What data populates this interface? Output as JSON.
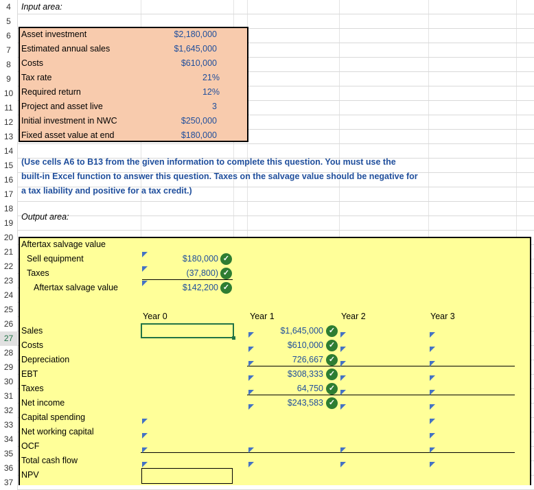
{
  "row_numbers": [
    "4",
    "5",
    "6",
    "7",
    "8",
    "9",
    "10",
    "11",
    "12",
    "13",
    "14",
    "15",
    "16",
    "17",
    "18",
    "19",
    "20",
    "21",
    "22",
    "23",
    "24",
    "25",
    "26",
    "27",
    "28",
    "29",
    "30",
    "31",
    "32",
    "33",
    "34",
    "35",
    "36",
    "37"
  ],
  "input": {
    "header": "Input area:",
    "labels": [
      "Asset investment",
      "Estimated annual sales",
      "Costs",
      "Tax rate",
      "Required return",
      "Project and asset live",
      "Initial investment in NWC",
      "Fixed asset value at end"
    ],
    "values": [
      "$2,180,000",
      "$1,645,000",
      "$610,000",
      "21%",
      "12%",
      "3",
      "$250,000",
      "$180,000"
    ]
  },
  "instructions": [
    "(Use cells A6 to B13 from the given information to complete this question. You must use the",
    "built-in Excel function to answer this question. Taxes on the salvage value should be negative for",
    "a tax liability and positive for a tax credit.)"
  ],
  "output": {
    "header": "Output area:",
    "salvage": {
      "title": "Aftertax salvage value",
      "sell_label": "Sell equipment",
      "taxes_label": "Taxes",
      "aftertax_label": "Aftertax salvage value",
      "sell_value": "$180,000",
      "taxes_value": "(37,800)",
      "aftertax_value": "$142,200"
    },
    "years": [
      "Year 0",
      "Year 1",
      "Year 2",
      "Year 3"
    ],
    "labels": [
      "Sales",
      "Costs",
      "Depreciation",
      "EBT",
      "Taxes",
      "Net income",
      "Capital spending",
      "Net working capital",
      "OCF",
      "Total cash flow",
      "NPV"
    ],
    "year1_values": [
      "$1,645,000",
      "$610,000",
      "726,667",
      "$308,333",
      "64,750",
      "$243,583"
    ]
  },
  "colors": {
    "input_fill": "#f8cbad",
    "output_fill": "#ffff99",
    "check": "#2e7d32",
    "flag": "#4472c4"
  }
}
